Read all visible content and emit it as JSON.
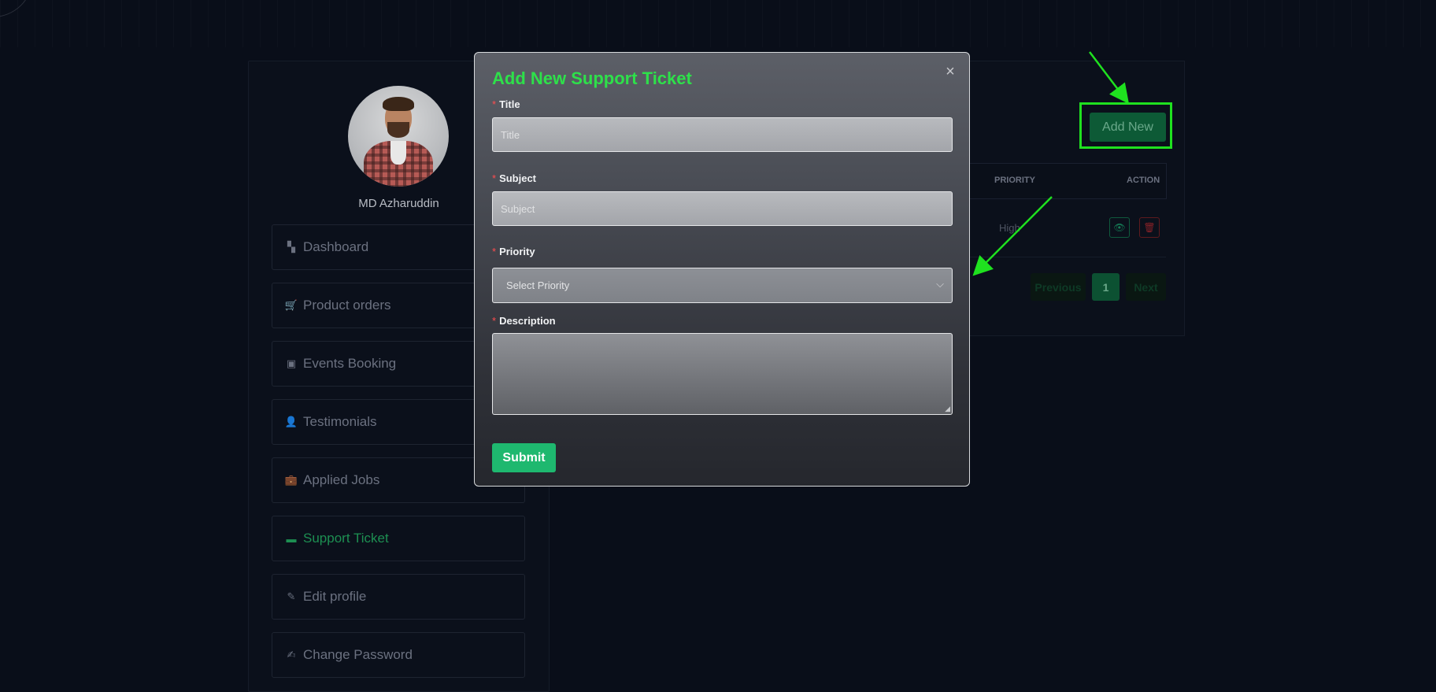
{
  "sidebar": {
    "username": "MD Azharuddin",
    "items": [
      {
        "label": "Dashboard",
        "icon": "dashboard-icon",
        "glyph": "▚"
      },
      {
        "label": "Product orders",
        "icon": "cart-icon",
        "glyph": "🛒"
      },
      {
        "label": "Events Booking",
        "icon": "calendar-icon",
        "glyph": "▣"
      },
      {
        "label": "Testimonials",
        "icon": "user-tie-icon",
        "glyph": "👤"
      },
      {
        "label": "Applied Jobs",
        "icon": "briefcase-icon",
        "glyph": "💼"
      },
      {
        "label": "Support Ticket",
        "icon": "ticket-icon",
        "glyph": "▬",
        "active": true
      },
      {
        "label": "Edit profile",
        "icon": "user-edit-icon",
        "glyph": "✎"
      },
      {
        "label": "Change Password",
        "icon": "edit-icon",
        "glyph": "✍"
      }
    ]
  },
  "main": {
    "add_new_label": "Add New",
    "table": {
      "headers": {
        "priority": "PRIORITY",
        "action": "ACTION"
      },
      "rows": [
        {
          "priority": "High"
        }
      ]
    },
    "pager": {
      "prev": "Previous",
      "current": "1",
      "next": "Next"
    }
  },
  "modal": {
    "title": "Add New Support Ticket",
    "close_glyph": "×",
    "fields": {
      "title": {
        "label": "Title",
        "placeholder": "Title"
      },
      "subject": {
        "label": "Subject",
        "placeholder": "Subject"
      },
      "priority": {
        "label": "Priority",
        "selected": "Select Priority"
      },
      "description": {
        "label": "Description"
      }
    },
    "required_mark": "*",
    "submit_label": "Submit"
  },
  "colors": {
    "background": "#090e19",
    "accent_green": "#2ee04a",
    "submit_green": "#1eb86f",
    "highlight_green": "#1fe11f",
    "required_red": "#ff4d4f"
  }
}
